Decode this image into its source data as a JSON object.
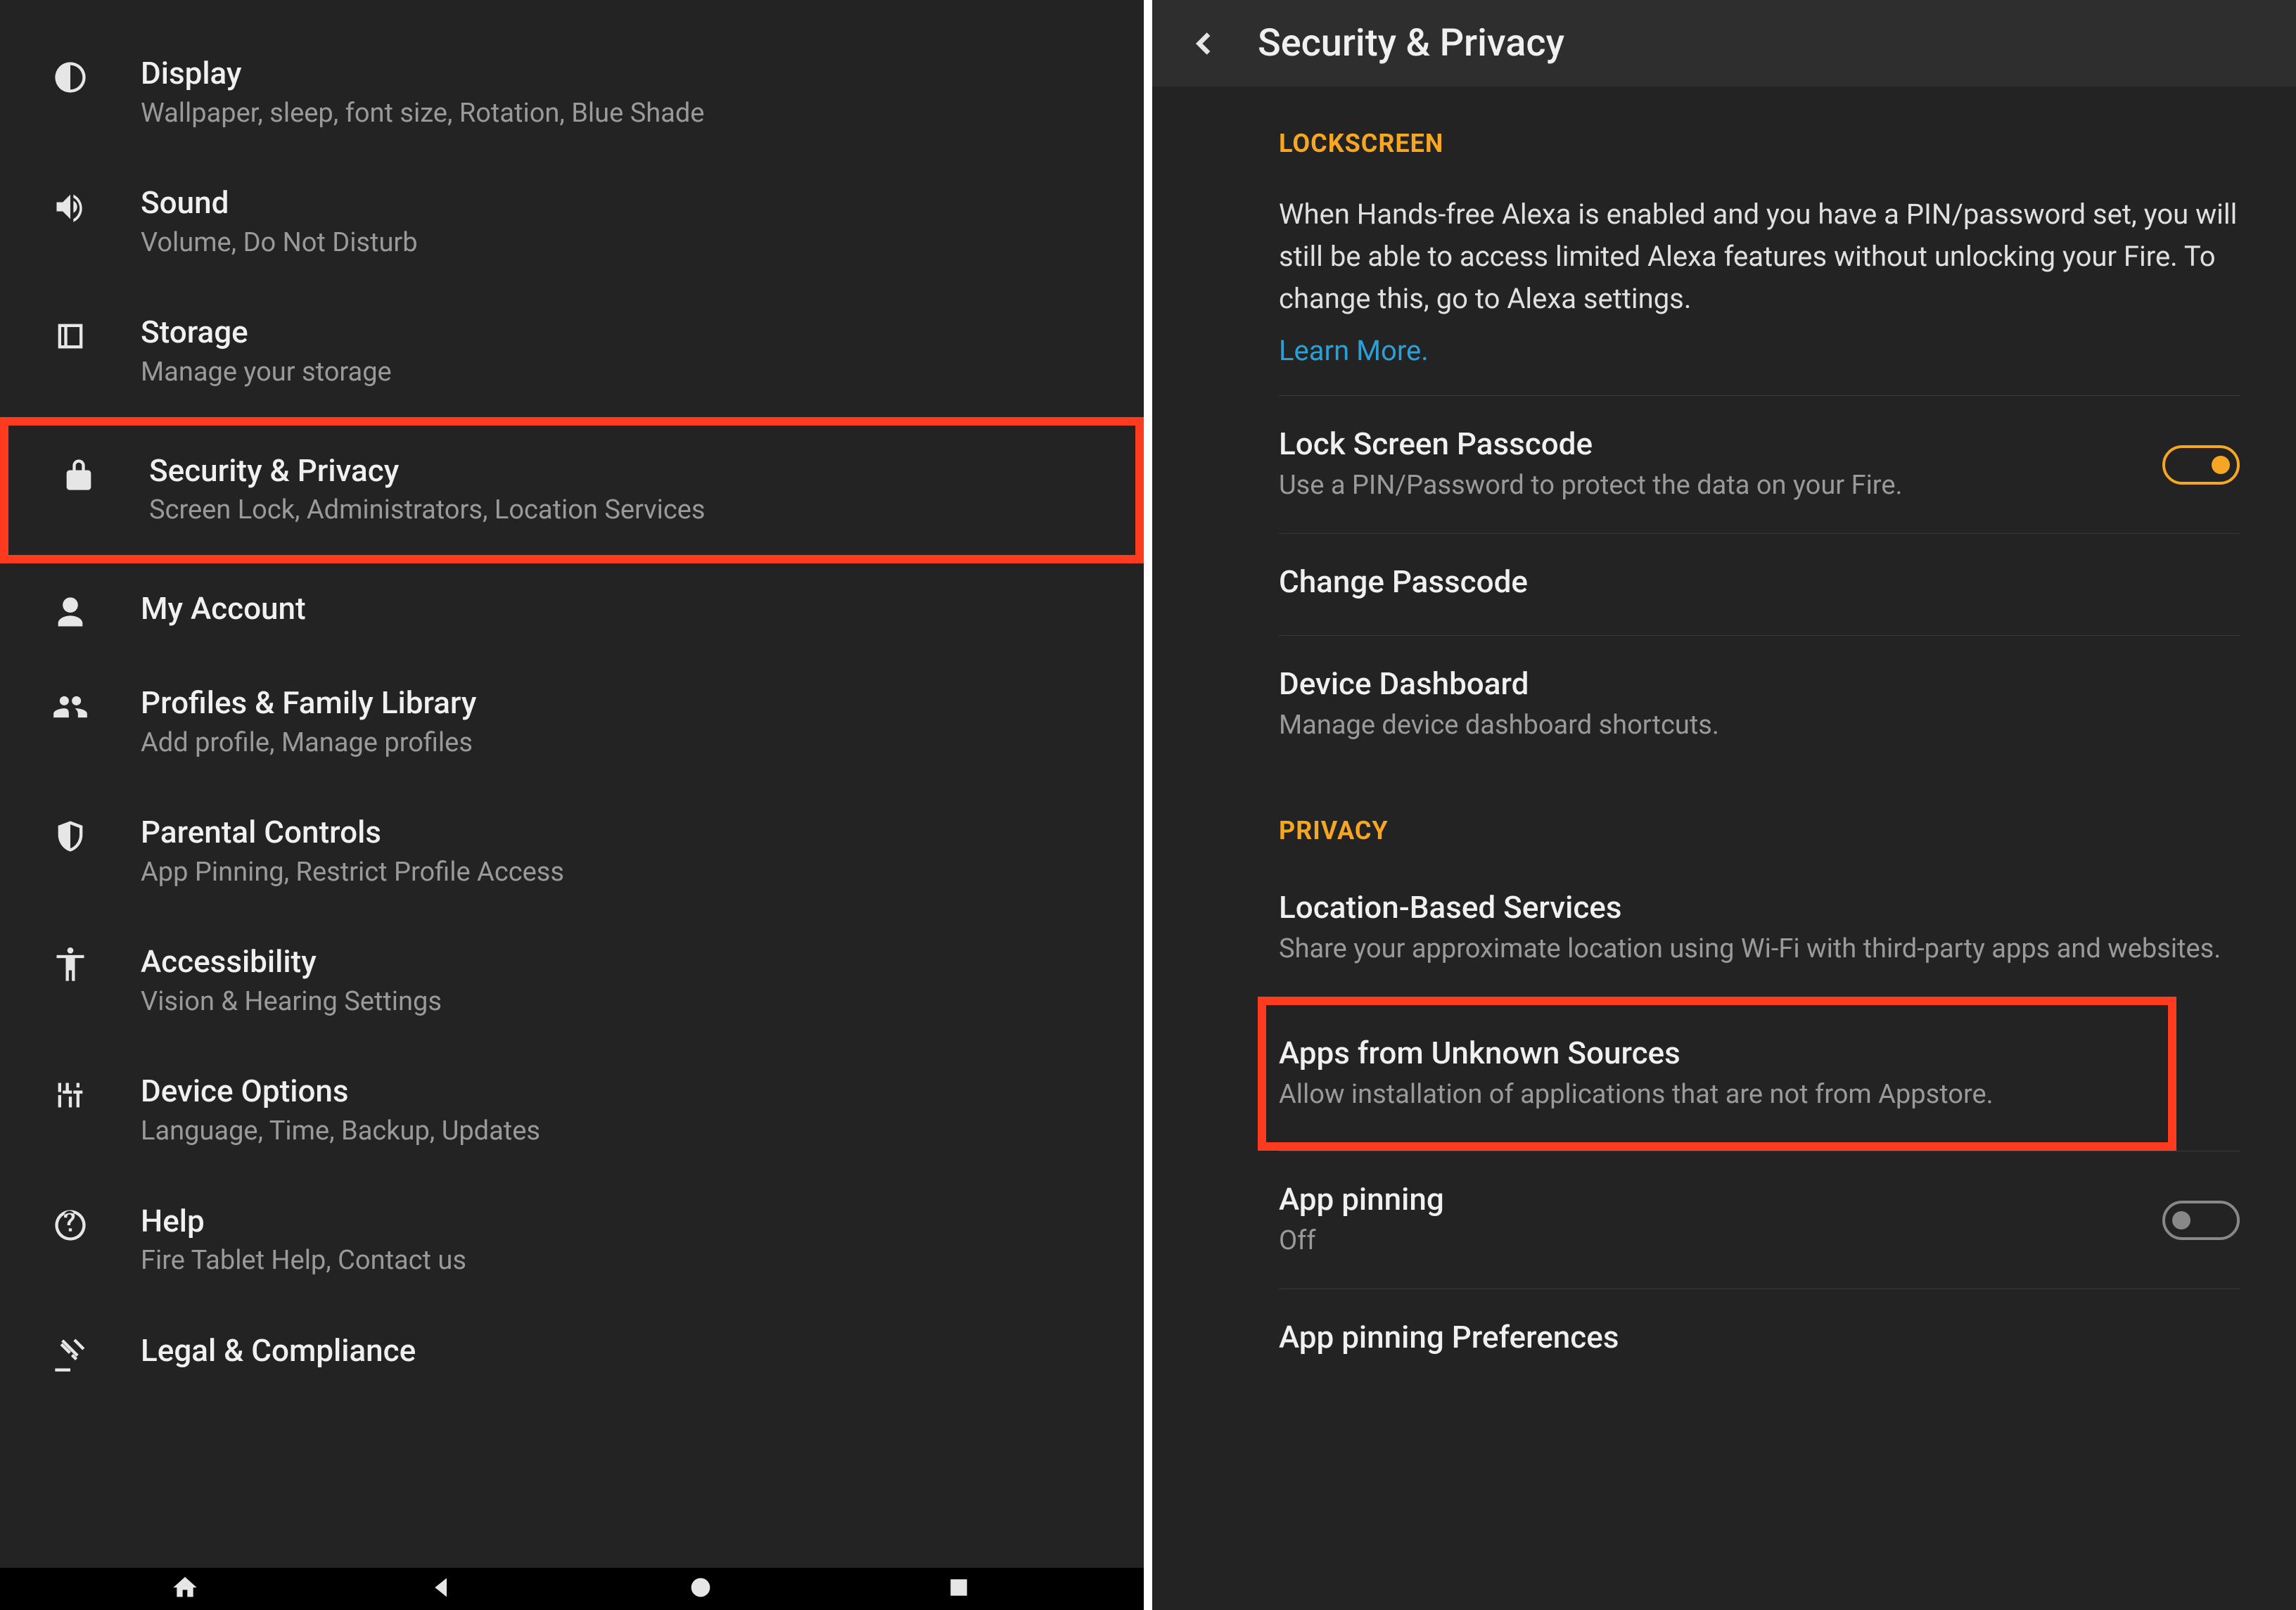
{
  "left_pane": {
    "items": [
      {
        "title": "Display",
        "subtitle": "Wallpaper, sleep, font size, Rotation, Blue Shade"
      },
      {
        "title": "Sound",
        "subtitle": "Volume, Do Not Disturb"
      },
      {
        "title": "Storage",
        "subtitle": "Manage your storage"
      },
      {
        "title": "Security & Privacy",
        "subtitle": "Screen Lock, Administrators, Location Services"
      },
      {
        "title": "My Account",
        "subtitle": ""
      },
      {
        "title": "Profiles & Family Library",
        "subtitle": "Add profile, Manage profiles"
      },
      {
        "title": "Parental Controls",
        "subtitle": "App Pinning, Restrict Profile Access"
      },
      {
        "title": "Accessibility",
        "subtitle": "Vision & Hearing Settings"
      },
      {
        "title": "Device Options",
        "subtitle": "Language, Time, Backup, Updates"
      },
      {
        "title": "Help",
        "subtitle": "Fire Tablet Help, Contact us"
      },
      {
        "title": "Legal & Compliance",
        "subtitle": ""
      }
    ]
  },
  "right_pane": {
    "header_title": "Security & Privacy",
    "section1": "Lockscreen",
    "lockscreen_body": "When Hands-free Alexa is enabled and you have a PIN/password set, you will still be able to access limited Alexa features without unlocking your Fire. To change this, go to Alexa settings.",
    "learn_more": "Learn More.",
    "lock_passcode": {
      "title": "Lock Screen Passcode",
      "sub": "Use a PIN/Password to protect the data on your Fire."
    },
    "change_passcode": {
      "title": "Change Passcode"
    },
    "device_dashboard": {
      "title": "Device Dashboard",
      "sub": "Manage device dashboard shortcuts."
    },
    "section2": "Privacy",
    "lbs": {
      "title": "Location-Based Services",
      "sub": "Share your approximate location using Wi-Fi with third-party apps and websites."
    },
    "unknown": {
      "title": "Apps from Unknown Sources",
      "sub": "Allow installation of applications that are not from Appstore."
    },
    "app_pinning": {
      "title": "App pinning",
      "sub": "Off"
    },
    "app_pinning_prefs": {
      "title": "App pinning Preferences"
    }
  }
}
